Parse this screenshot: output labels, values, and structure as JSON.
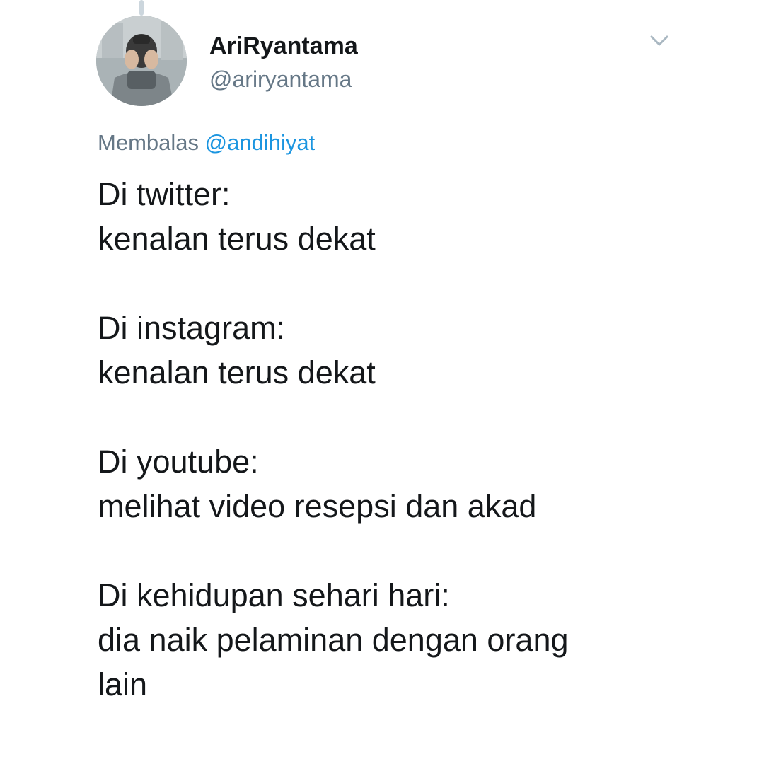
{
  "author": {
    "display_name": "AriRyantama",
    "handle": "@ariryantama",
    "avatar_icon": "profile-photo-avatar"
  },
  "menu": {
    "icon": "chevron-down-icon"
  },
  "reply": {
    "prefix": "Membalas",
    "mention": "@andihiyat"
  },
  "tweet": {
    "lines": [
      "Di twitter:",
      "kenalan terus dekat",
      "",
      "Di instagram:",
      "kenalan terus dekat",
      "",
      "Di youtube:",
      "melihat video resepsi dan akad",
      "",
      "Di kehidupan sehari hari:",
      "dia naik pelaminan dengan orang",
      "lain"
    ]
  },
  "colors": {
    "text_primary": "#14171a",
    "text_secondary": "#657786",
    "link": "#1b95e0",
    "thread_line": "#ccd6dd",
    "background": "#ffffff"
  }
}
